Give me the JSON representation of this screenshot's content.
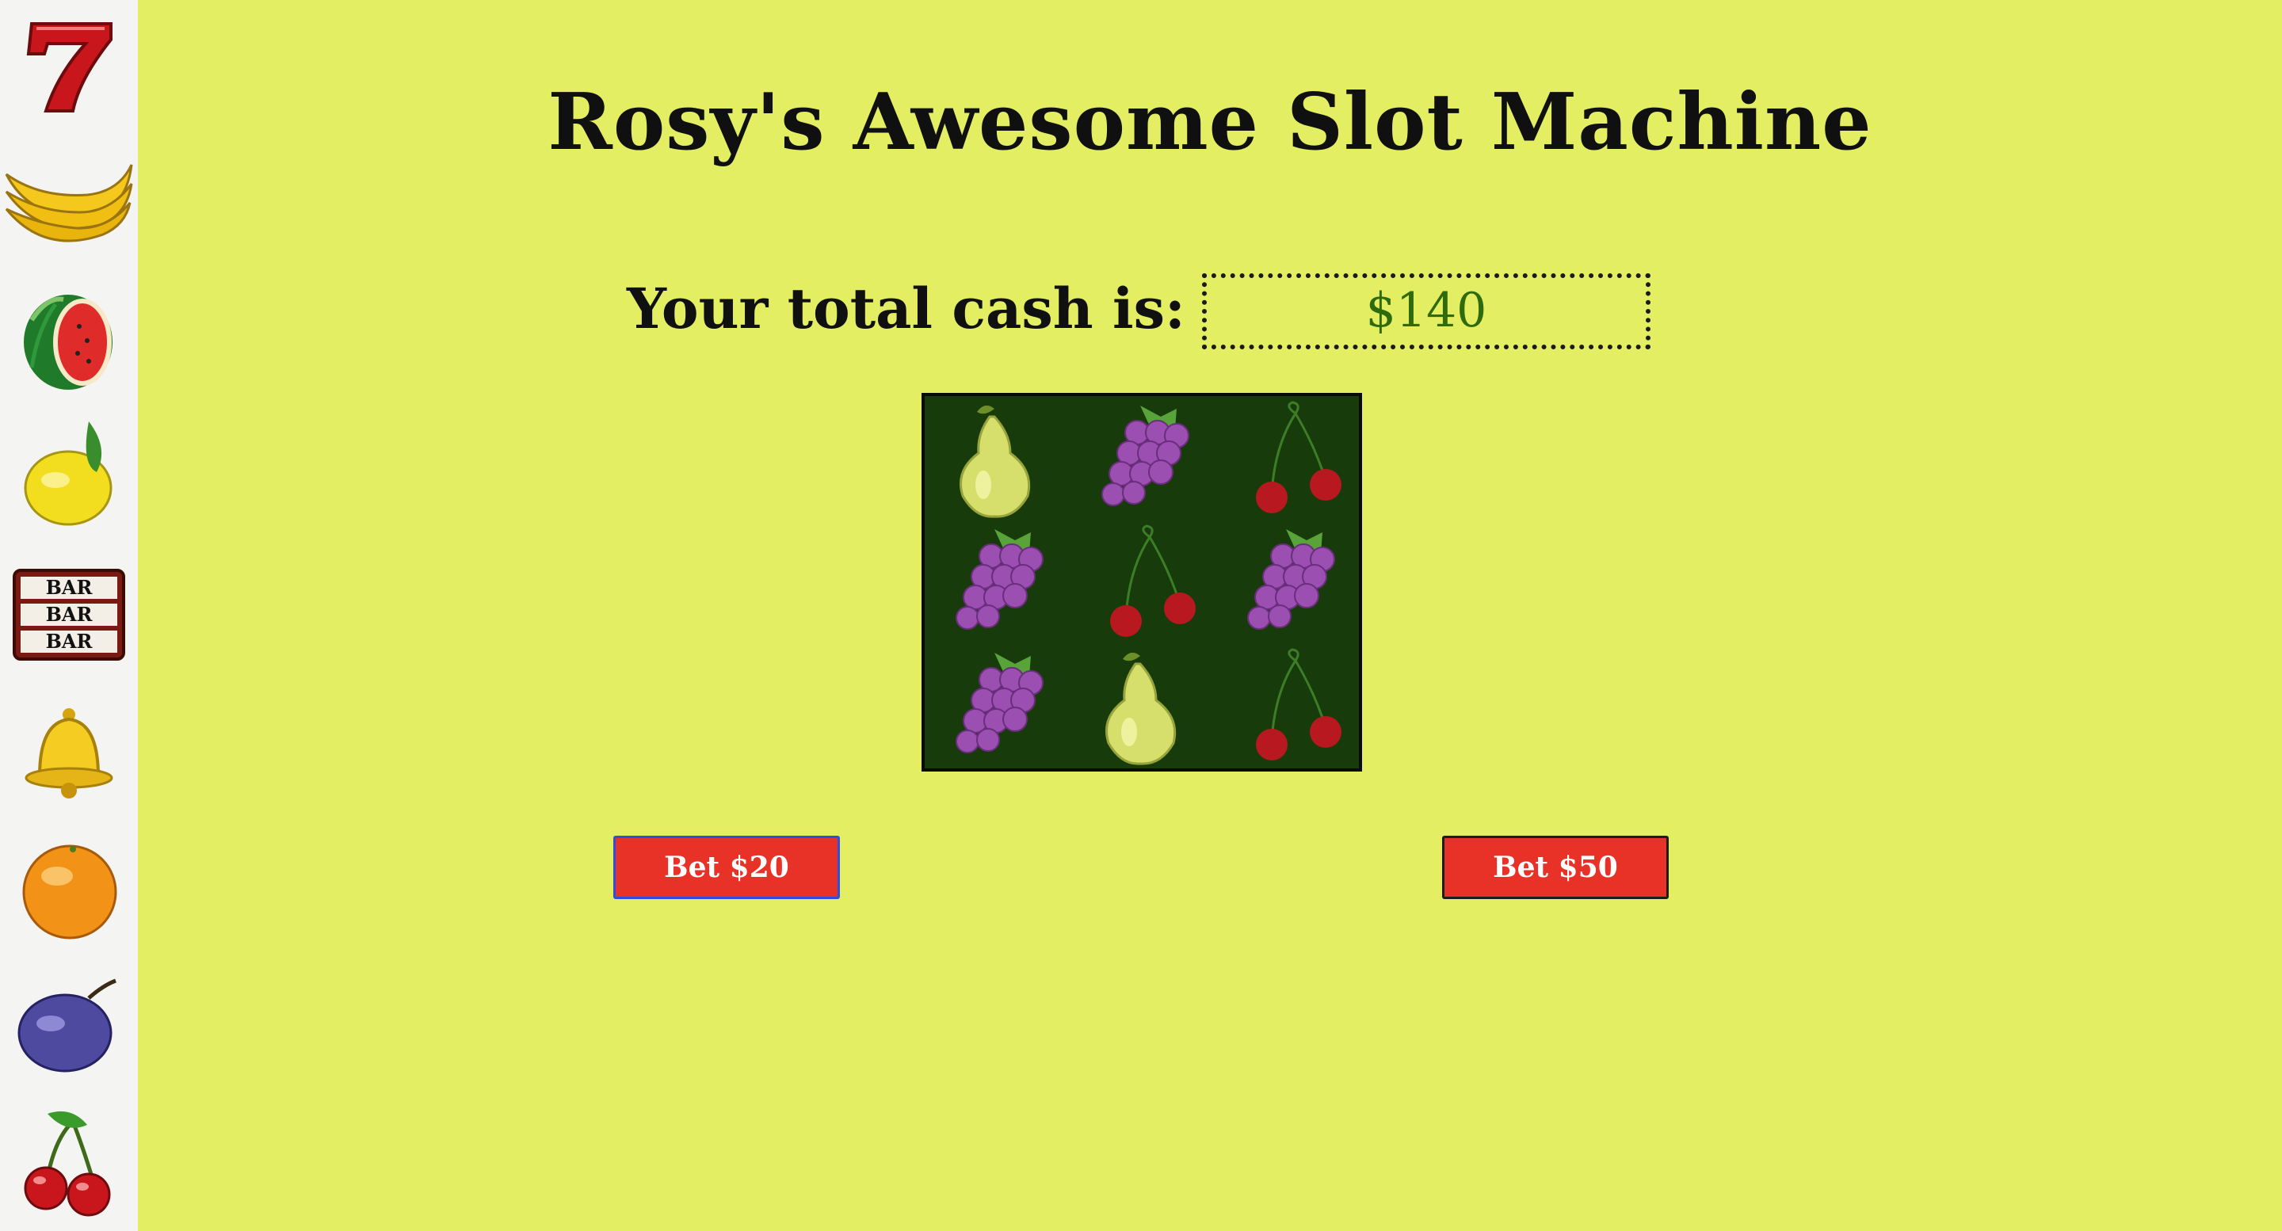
{
  "title": "Rosy's Awesome Slot Machine",
  "cash": {
    "label": "Your total cash is:",
    "value": "$140"
  },
  "sidebar_icons": [
    "seven-icon",
    "banana-icon",
    "watermelon-icon",
    "lemon-icon",
    "bar-icon",
    "bell-icon",
    "orange-icon",
    "plum-icon",
    "cherry-icon"
  ],
  "bar_icon_text": [
    "BAR",
    "BAR",
    "BAR"
  ],
  "reels": [
    [
      "pear",
      "grapes",
      "cherry"
    ],
    [
      "grapes",
      "cherry",
      "grapes"
    ],
    [
      "grapes",
      "pear",
      "cherry"
    ]
  ],
  "buttons": {
    "bet_20": "Bet $20",
    "bet_50": "Bet $50"
  },
  "colors": {
    "background": "#e3ee62",
    "sidebar": "#f4f4f2",
    "reel_background": "#173b0a",
    "button": "#e83228",
    "cash_text": "#2f6a0c"
  }
}
